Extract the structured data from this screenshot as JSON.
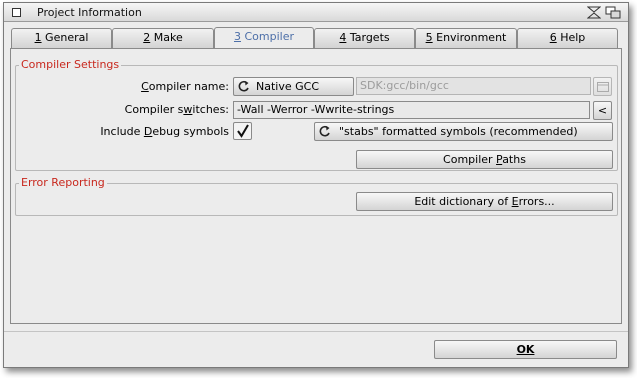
{
  "window": {
    "title": "Project Information",
    "close_icon": "close-icon",
    "zoom_icon": "zoom-icon",
    "depth_icon": "depth-icon"
  },
  "tabs": [
    {
      "key": "1",
      "label": " General"
    },
    {
      "key": "2",
      "label": " Make"
    },
    {
      "key": "3",
      "label": " Compiler",
      "active": true
    },
    {
      "key": "4",
      "label": " Targets"
    },
    {
      "key": "5",
      "label": " Environment"
    },
    {
      "key": "6",
      "label": " Help"
    }
  ],
  "compiler_settings": {
    "legend": "Compiler Settings",
    "name_label_pre": "",
    "name_label_ul": "C",
    "name_label_post": "ompiler name:",
    "name_value": "Native GCC",
    "path_value": "SDK:gcc/bin/gcc",
    "switches_label_pre": "Compiler s",
    "switches_label_ul": "w",
    "switches_label_post": "itches:",
    "switches_value": "-Wall -Werror -Wwrite-strings",
    "switches_btn": "<",
    "debug_label_pre": "Include ",
    "debug_label_ul": "D",
    "debug_label_post": "ebug symbols",
    "debug_checked": true,
    "debug_format": "\"stabs\" formatted symbols (recommended)",
    "paths_btn_pre": "Compiler ",
    "paths_btn_ul": "P",
    "paths_btn_post": "aths"
  },
  "error_reporting": {
    "legend": "Error Reporting",
    "edit_btn_pre": "Edit dictionary of ",
    "edit_btn_ul": "E",
    "edit_btn_post": "rrors..."
  },
  "ok_btn": "OK",
  "colors": {
    "legend": "#c8281e",
    "active_tab": "#4d6fa8",
    "background": "#ececec"
  }
}
